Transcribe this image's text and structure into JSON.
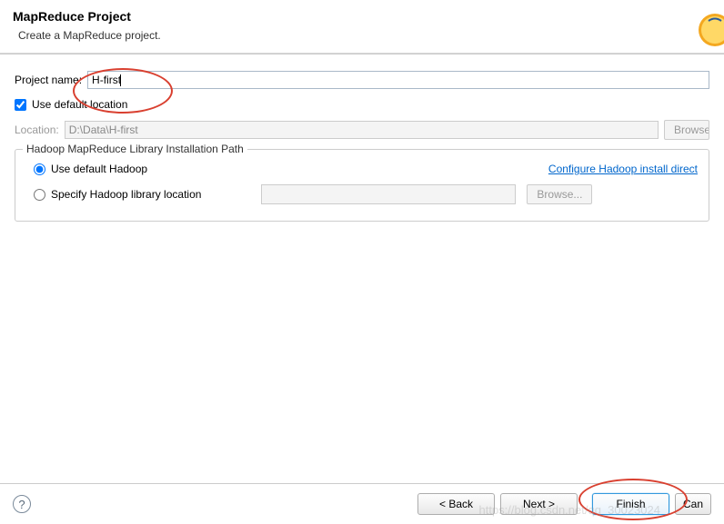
{
  "header": {
    "title": "MapReduce Project",
    "subtitle": "Create a MapReduce project."
  },
  "form": {
    "projectNameLabel": "Project name:",
    "projectNameValue": "H-first",
    "useDefaultLocationLabel": "Use default location",
    "useDefaultLocationChecked": true,
    "locationLabel": "Location:",
    "locationValue": "D:\\Data\\H-first",
    "browseLabel": "Browse"
  },
  "hadoopSection": {
    "legend": "Hadoop MapReduce Library Installation Path",
    "useDefaultHadoopLabel": "Use default Hadoop",
    "configureLink": "Configure Hadoop install direct",
    "specifyLibraryLabel": "Specify Hadoop library location",
    "browseDisabledLabel": "Browse..."
  },
  "footer": {
    "helpTooltip": "?",
    "backLabel": "< Back",
    "nextLabel": "Next >",
    "finishLabel": "Finish",
    "cancelLabel": "Can"
  },
  "watermark": "https://blog.csdn.net/qq_30023024"
}
